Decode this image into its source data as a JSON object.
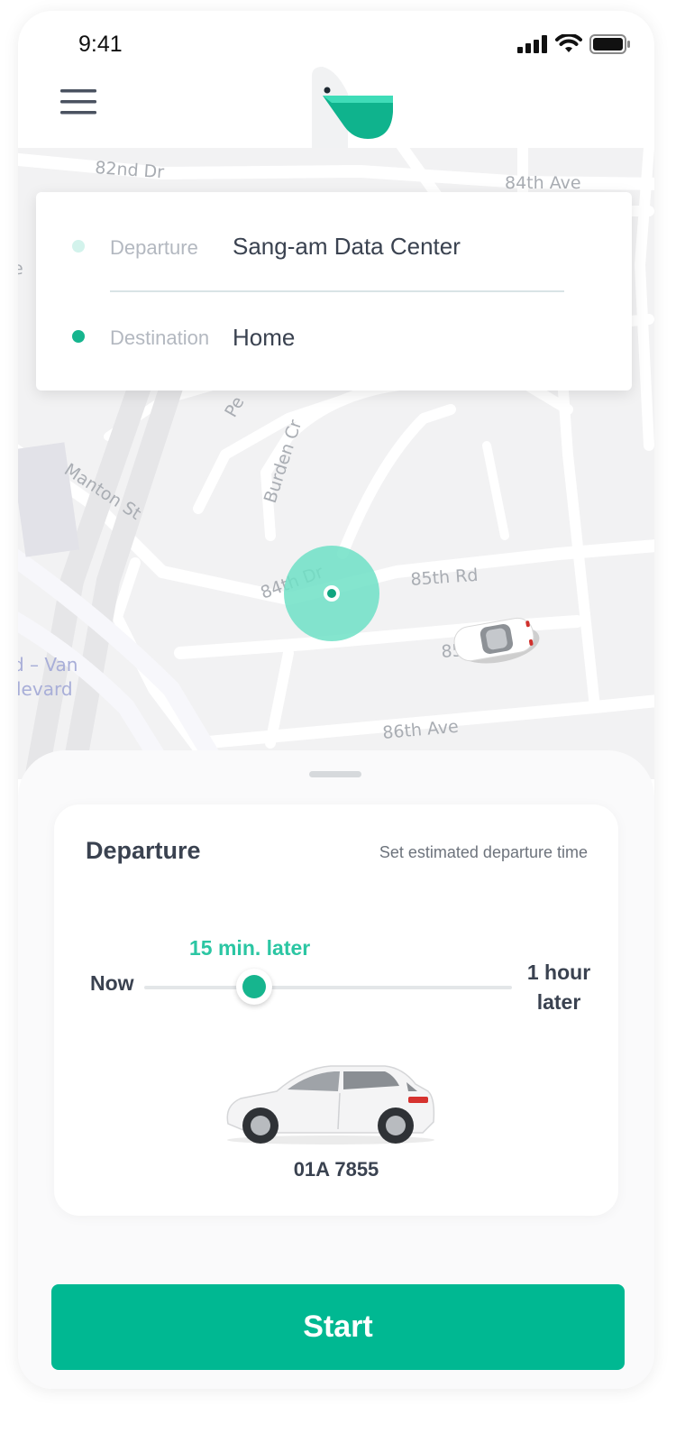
{
  "status_bar": {
    "time": "9:41"
  },
  "map": {
    "streets": [
      "82nd Dr",
      "84th Ave",
      "Pe",
      "Burden Cr",
      "Manton St",
      "84th Dr",
      "85th Rd",
      "85",
      "86th Ave",
      "d – Van",
      "levard",
      "e"
    ]
  },
  "route": {
    "departure_label": "Departure",
    "departure_value": "Sang-am Data Center",
    "destination_label": "Destination",
    "destination_value": "Home"
  },
  "departure_panel": {
    "title": "Departure",
    "hint": "Set estimated departure time",
    "slider": {
      "value_label": "15 min. later",
      "min_label": "Now",
      "max_label": "1 hour later",
      "min_minutes": 0,
      "max_minutes": 60,
      "value_minutes": 15
    },
    "vehicle": {
      "plate": "01A 7855"
    }
  },
  "actions": {
    "start_label": "Start"
  },
  "colors": {
    "accent": "#00b892",
    "departure_dot": "#d3f3ec",
    "destination_dot": "#16b58e",
    "location_circle": "#6ee0c5"
  },
  "icons": [
    "menu-icon",
    "app-logo-icon",
    "signal-icon",
    "wifi-icon",
    "battery-icon",
    "location-pin-icon",
    "car-icon"
  ]
}
